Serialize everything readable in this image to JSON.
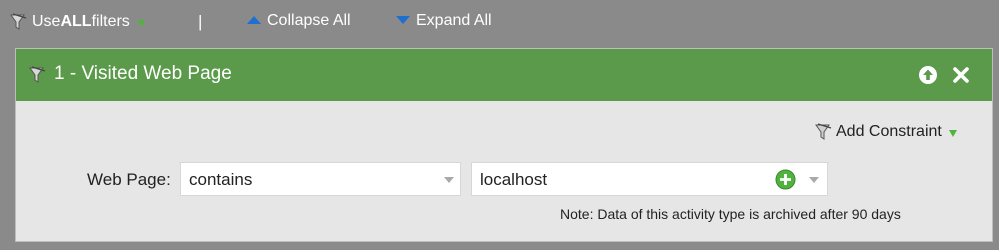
{
  "toolbar": {
    "use_filters_prefix": "Use ",
    "use_filters_bold": "ALL",
    "use_filters_suffix": " filters",
    "separator": "|",
    "collapse_all": "Collapse All",
    "expand_all": "Expand All"
  },
  "filter": {
    "title": "1 - Visited Web Page",
    "add_constraint": "Add Constraint",
    "field_label": "Web Page:",
    "operator": "contains",
    "value": "localhost",
    "note": "Note: Data of this activity type is archived after 90 days"
  },
  "colors": {
    "background": "#8a8a8a",
    "header": "#5a9a4a",
    "panel": "#e6e6e6",
    "accent_green": "#4fb33e",
    "accent_blue": "#1f6fd0"
  },
  "icons": [
    "funnel-icon",
    "dropdown-triangle-icon",
    "collapse-triangle-icon",
    "expand-triangle-icon",
    "arrow-up-circle-icon",
    "close-icon",
    "add-circle-icon",
    "chevron-down-icon"
  ]
}
